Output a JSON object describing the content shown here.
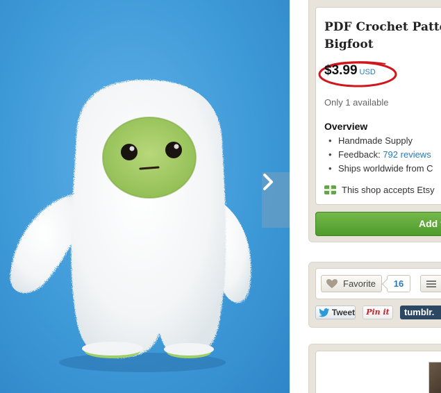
{
  "listing": {
    "title_line1": "PDF Crochet Pattern",
    "title_line2": "Bigfoot",
    "price": "$3.99",
    "currency": "USD",
    "availability": "Only 1 available",
    "overview_heading": "Overview",
    "overview_items": [
      {
        "label": "Handmade Supply",
        "link": ""
      },
      {
        "label": "Feedback: ",
        "link": "792 reviews"
      },
      {
        "label": "Ships worldwide from C",
        "link": ""
      }
    ],
    "giftcard_text": "This shop accepts Etsy",
    "add_to_cart_label": "Add t"
  },
  "social": {
    "favorite_label": "Favorite",
    "favorite_count": "16",
    "tweet_label": "Tweet",
    "pinit_label": "Pin it",
    "tumblr_label": "tumblr."
  },
  "photo": {
    "next_arrow_icon": "chevron-right-icon",
    "background_color": "#3f9ad8"
  },
  "colors": {
    "price_ring": "#d0171d",
    "link": "#2a7ab5",
    "cart_green": "#5aa533",
    "panel": "#e8e4dc"
  }
}
